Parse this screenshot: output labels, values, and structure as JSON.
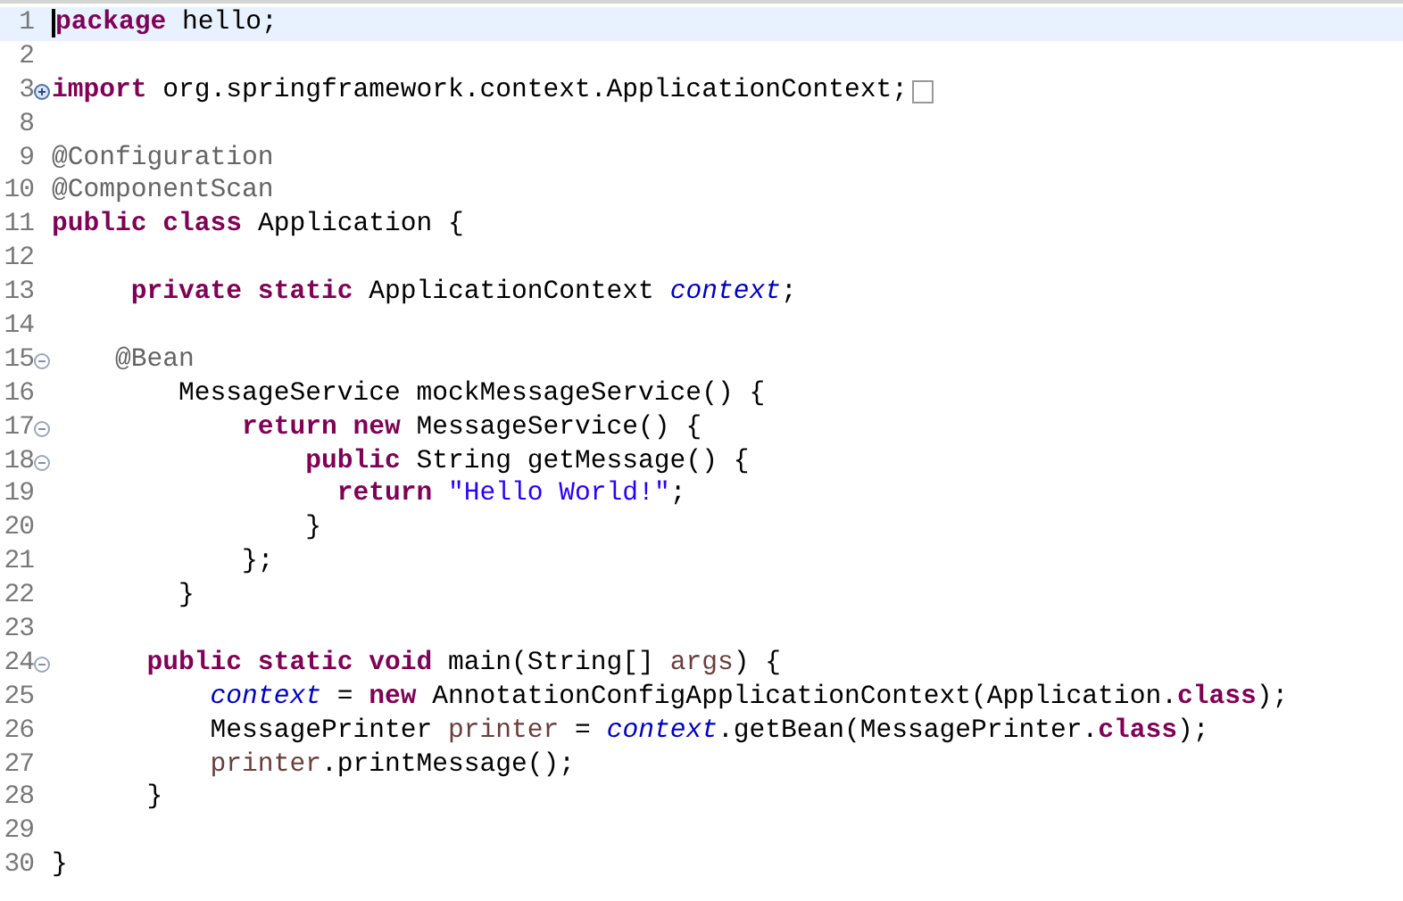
{
  "editor": {
    "lines": [
      {
        "number": "1",
        "current": true,
        "tokens": [
          {
            "kind": "keyword",
            "text": "package"
          },
          {
            "kind": "plain",
            "text": " hello;"
          }
        ]
      },
      {
        "number": "2",
        "current": false
      },
      {
        "number": "3",
        "fold": {
          "expanded": false
        },
        "current": false,
        "tokens": [
          {
            "kind": "keyword",
            "text": "import"
          },
          {
            "kind": "plain",
            "text": " org.springframework.context.ApplicationContext;"
          }
        ]
      },
      {
        "number": "8",
        "current": false
      },
      {
        "number": "9",
        "current": false,
        "tokens": [
          {
            "kind": "annotation",
            "text": "@Configuration"
          }
        ]
      },
      {
        "number": "10",
        "current": false,
        "tokens": [
          {
            "kind": "annotation",
            "text": "@ComponentScan"
          }
        ]
      },
      {
        "number": "11",
        "current": false,
        "tokens": [
          {
            "kind": "keyword",
            "text": "public class"
          },
          {
            "kind": "plain",
            "text": " Application {"
          }
        ]
      },
      {
        "number": "12",
        "current": false
      },
      {
        "number": "13",
        "current": false,
        "tokens": [
          {
            "kind": "keyword",
            "text": "     private static"
          },
          {
            "kind": "plain",
            "text": " ApplicationContext "
          },
          {
            "kind": "field",
            "text": "context"
          },
          {
            "kind": "plain",
            "text": ";"
          }
        ]
      },
      {
        "number": "14",
        "current": false
      },
      {
        "number": "15",
        "fold": {
          "expanded": true
        },
        "current": false,
        "tokens": [
          {
            "kind": "annotation",
            "text": "    @Bean"
          }
        ]
      },
      {
        "number": "16",
        "current": false,
        "tokens": [
          {
            "kind": "plain",
            "text": "        MessageService mockMessageService() {"
          }
        ]
      },
      {
        "number": "17",
        "fold": {
          "expanded": true
        },
        "current": false,
        "tokens": [
          {
            "kind": "keyword",
            "text": "            return new"
          },
          {
            "kind": "plain",
            "text": " MessageService() {"
          }
        ]
      },
      {
        "number": "18",
        "fold": {
          "expanded": true
        },
        "current": false,
        "tokens": [
          {
            "kind": "keyword",
            "text": "                public"
          },
          {
            "kind": "plain",
            "text": " String getMessage() {"
          }
        ]
      },
      {
        "number": "19",
        "current": false,
        "tokens": [
          {
            "kind": "keyword",
            "text": "                  return"
          },
          {
            "kind": "string",
            "text": " \"Hello World!\""
          },
          {
            "kind": "plain",
            "text": ";"
          }
        ]
      },
      {
        "number": "20",
        "current": false,
        "tokens": [
          {
            "kind": "plain",
            "text": "                }"
          }
        ]
      },
      {
        "number": "21",
        "current": false,
        "tokens": [
          {
            "kind": "plain",
            "text": "            };"
          }
        ]
      },
      {
        "number": "22",
        "current": false,
        "tokens": [
          {
            "kind": "plain",
            "text": "        }"
          }
        ]
      },
      {
        "number": "23",
        "current": false
      },
      {
        "number": "24",
        "fold": {
          "expanded": true
        },
        "current": false,
        "tokens": [
          {
            "kind": "keyword",
            "text": "      public static void"
          },
          {
            "kind": "plain",
            "text": " main(String[] "
          },
          {
            "kind": "local",
            "text": "args"
          },
          {
            "kind": "plain",
            "text": ") {"
          }
        ]
      },
      {
        "number": "25",
        "current": false,
        "tokens": [
          {
            "kind": "field",
            "text": "          context"
          },
          {
            "kind": "plain",
            "text": " = "
          },
          {
            "kind": "keyword",
            "text": "new"
          },
          {
            "kind": "plain",
            "text": " AnnotationConfigApplicationContext(Application."
          },
          {
            "kind": "keyword",
            "text": "class"
          },
          {
            "kind": "plain",
            "text": ");"
          }
        ]
      },
      {
        "number": "26",
        "current": false,
        "tokens": [
          {
            "kind": "plain",
            "text": "          MessagePrinter "
          },
          {
            "kind": "local",
            "text": "printer"
          },
          {
            "kind": "plain",
            "text": " = "
          },
          {
            "kind": "field",
            "text": "context"
          },
          {
            "kind": "plain",
            "text": ".getBean(MessagePrinter."
          },
          {
            "kind": "keyword",
            "text": "class"
          },
          {
            "kind": "plain",
            "text": ");"
          }
        ]
      },
      {
        "number": "27",
        "current": false,
        "tokens": [
          {
            "kind": "local",
            "text": "          printer"
          },
          {
            "kind": "plain",
            "text": ".printMessage();"
          }
        ]
      },
      {
        "number": "28",
        "current": false,
        "tokens": [
          {
            "kind": "plain",
            "text": "      }"
          }
        ]
      },
      {
        "number": "29",
        "current": false
      },
      {
        "number": "30",
        "current": false,
        "tokens": [
          {
            "kind": "plain",
            "text": "}"
          }
        ]
      }
    ]
  }
}
